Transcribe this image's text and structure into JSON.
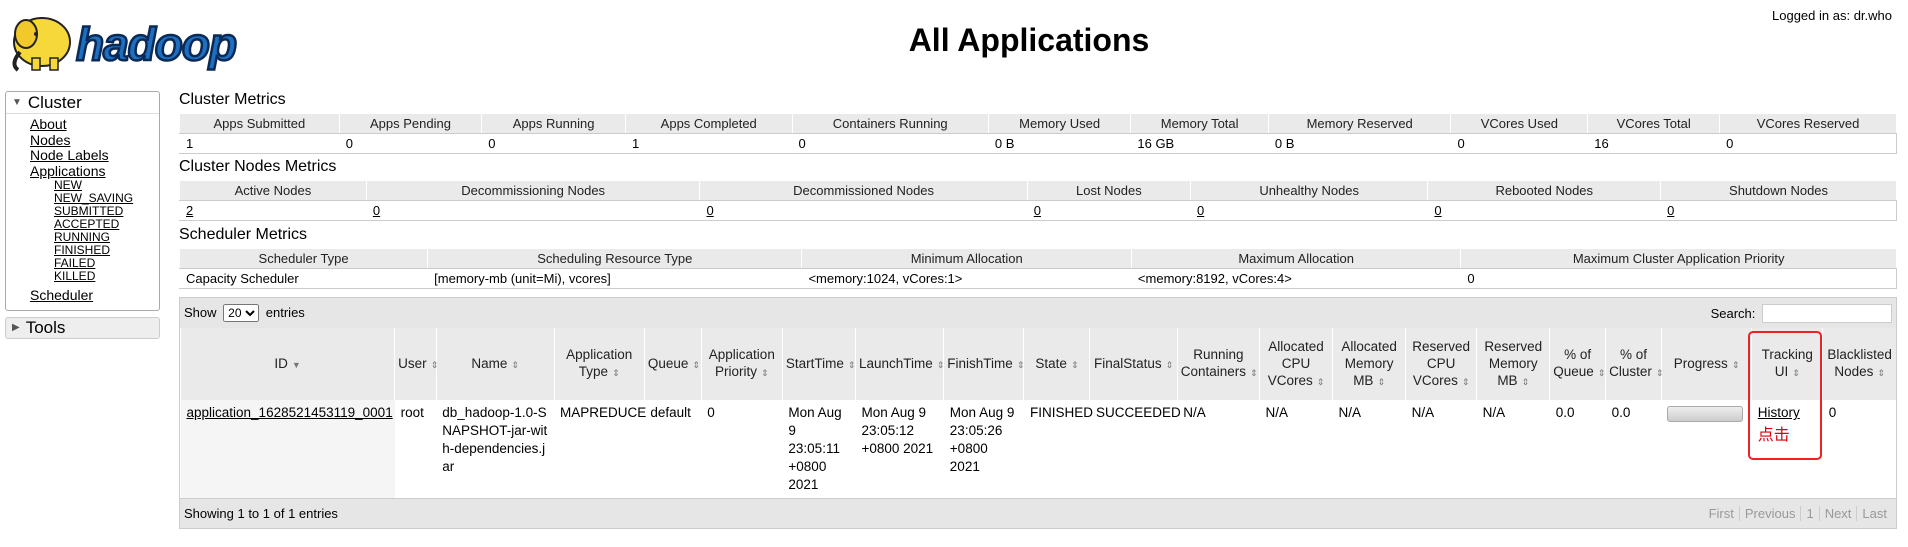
{
  "header": {
    "logo_text": "hadoop",
    "title": "All Applications",
    "logged_in": "Logged in as: dr.who"
  },
  "nav": {
    "cluster_label": "Cluster",
    "links": [
      "About",
      "Nodes",
      "Node Labels",
      "Applications"
    ],
    "app_states": [
      "NEW",
      "NEW_SAVING",
      "SUBMITTED",
      "ACCEPTED",
      "RUNNING",
      "FINISHED",
      "FAILED",
      "KILLED"
    ],
    "scheduler": "Scheduler",
    "tools_label": "Tools"
  },
  "cluster_metrics": {
    "title": "Cluster Metrics",
    "headers": [
      "Apps Submitted",
      "Apps Pending",
      "Apps Running",
      "Apps Completed",
      "Containers Running",
      "Memory Used",
      "Memory Total",
      "Memory Reserved",
      "VCores Used",
      "VCores Total",
      "VCores Reserved"
    ],
    "values": [
      "1",
      "0",
      "0",
      "1",
      "0",
      "0 B",
      "16 GB",
      "0 B",
      "0",
      "16",
      "0"
    ]
  },
  "node_metrics": {
    "title": "Cluster Nodes Metrics",
    "headers": [
      "Active Nodes",
      "Decommissioning Nodes",
      "Decommissioned Nodes",
      "Lost Nodes",
      "Unhealthy Nodes",
      "Rebooted Nodes",
      "Shutdown Nodes"
    ],
    "values": [
      "2",
      "0",
      "0",
      "0",
      "0",
      "0",
      "0"
    ]
  },
  "scheduler_metrics": {
    "title": "Scheduler Metrics",
    "headers": [
      "Scheduler Type",
      "Scheduling Resource Type",
      "Minimum Allocation",
      "Maximum Allocation",
      "Maximum Cluster Application Priority"
    ],
    "values": [
      "Capacity Scheduler",
      "[memory-mb (unit=Mi), vcores]",
      "<memory:1024, vCores:1>",
      "<memory:8192, vCores:4>",
      "0"
    ]
  },
  "apps": {
    "show_label": "Show",
    "entries_label": "entries",
    "page_size": "20",
    "search_label": "Search:",
    "columns": [
      "ID",
      "User",
      "Name",
      "Application Type",
      "Queue",
      "Application Priority",
      "StartTime",
      "LaunchTime",
      "FinishTime",
      "State",
      "FinalStatus",
      "Running Containers",
      "Allocated CPU VCores",
      "Allocated Memory MB",
      "Reserved CPU VCores",
      "Reserved Memory MB",
      "% of Queue",
      "% of Cluster",
      "Progress",
      "Tracking UI",
      "Blacklisted Nodes"
    ],
    "row": {
      "id": "application_1628521453119_0001",
      "user": "root",
      "name": "db_hadoop-1.0-SNAPSHOT-jar-with-dependencies.jar",
      "type": "MAPREDUCE",
      "queue": "default",
      "priority": "0",
      "start": "Mon Aug 9 23:05:11 +0800 2021",
      "launch": "Mon Aug 9 23:05:12 +0800 2021",
      "finish": "Mon Aug 9 23:05:26 +0800 2021",
      "state": "FINISHED",
      "final_status": "SUCCEEDED",
      "running_containers": "N/A",
      "alloc_vcores": "N/A",
      "alloc_mem": "N/A",
      "res_vcores": "N/A",
      "res_mem": "N/A",
      "pct_queue": "0.0",
      "pct_cluster": "0.0",
      "progress": 0,
      "tracking": "History",
      "blacklisted": "0"
    },
    "annotation": "点击",
    "footer": "Showing 1 to 1 of 1 entries",
    "pager": [
      "First",
      "Previous",
      "1",
      "Next",
      "Last"
    ]
  },
  "colors": {
    "annotation_red": "#e22222"
  }
}
